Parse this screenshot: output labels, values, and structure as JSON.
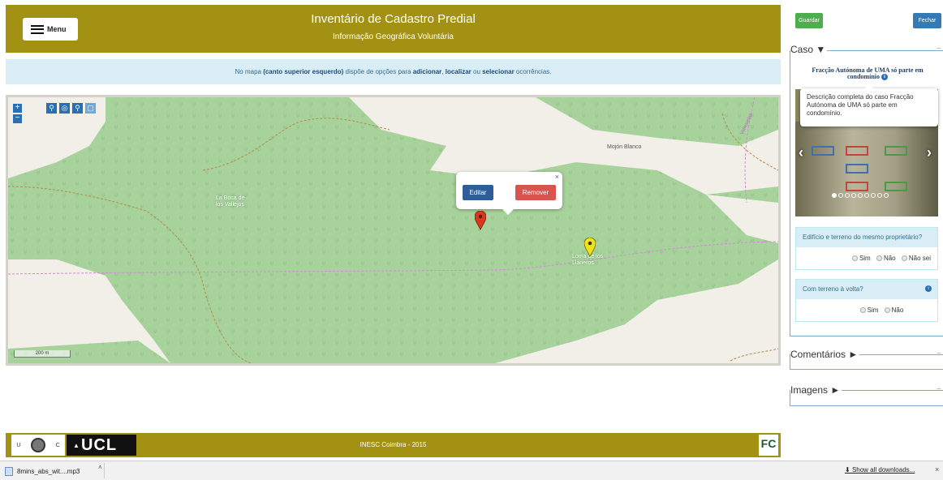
{
  "header": {
    "menu_label": "Menu",
    "title": "Inventário de Cadastro Predial",
    "subtitle": "Informação Geográfica Voluntária"
  },
  "info": {
    "t1": "No mapa ",
    "b1": "(canto superior esquerdo)",
    "t2": " dispõe de opções para ",
    "b2": "adicionar",
    "t3": ", ",
    "b3": "localizar",
    "t4": " ou ",
    "b4": "selecionar",
    "t5": " ocorrências."
  },
  "map": {
    "zoom_in": "+",
    "zoom_out": "−",
    "scale_label": "200 m",
    "labels": {
      "mojon": "Mojón Blanco",
      "boca": "La Boca de los Vallejos",
      "loma": "Loma de los Llaneros",
      "road": "Vallejuelas"
    },
    "popup": {
      "edit_label": "Editar",
      "remove_label": "Remover",
      "close_label": "×"
    },
    "colors": {
      "forest": "#a8d29c",
      "land": "#f2efe9",
      "marker_red": "#d9381e",
      "marker_yellow": "#f3e21a"
    }
  },
  "footer": {
    "uc_letters": [
      "U",
      "C"
    ],
    "ucl_label": "UCL",
    "fc_label": "FC",
    "text": "INESC Coimbra - 2015"
  },
  "downloads": {
    "file": "8mins_abs_wit....mp3",
    "caret": "˄",
    "show_all": "Show all downloads...",
    "close": "×"
  },
  "panel": {
    "save_label": "Guardar",
    "close_label": "Fechar",
    "caso_label": "Caso ▼",
    "caso_title": "Fracção Autónoma de UMA só parte em condomínio",
    "tooltip": "Descrição completa do caso Fracção Autónoma de UMA só parte em condomínio.",
    "carousel_dots": 9,
    "q1": {
      "text": "Edifício e terreno do mesmo proprietário?",
      "options": [
        "Sim",
        "Não",
        "Não sei"
      ]
    },
    "q2": {
      "text": "Com terreno à volta?",
      "options": [
        "Sim",
        "Não"
      ]
    },
    "comentarios_label": "Comentários ►",
    "imagens_label": "Imagens ►",
    "collapse": "−"
  }
}
